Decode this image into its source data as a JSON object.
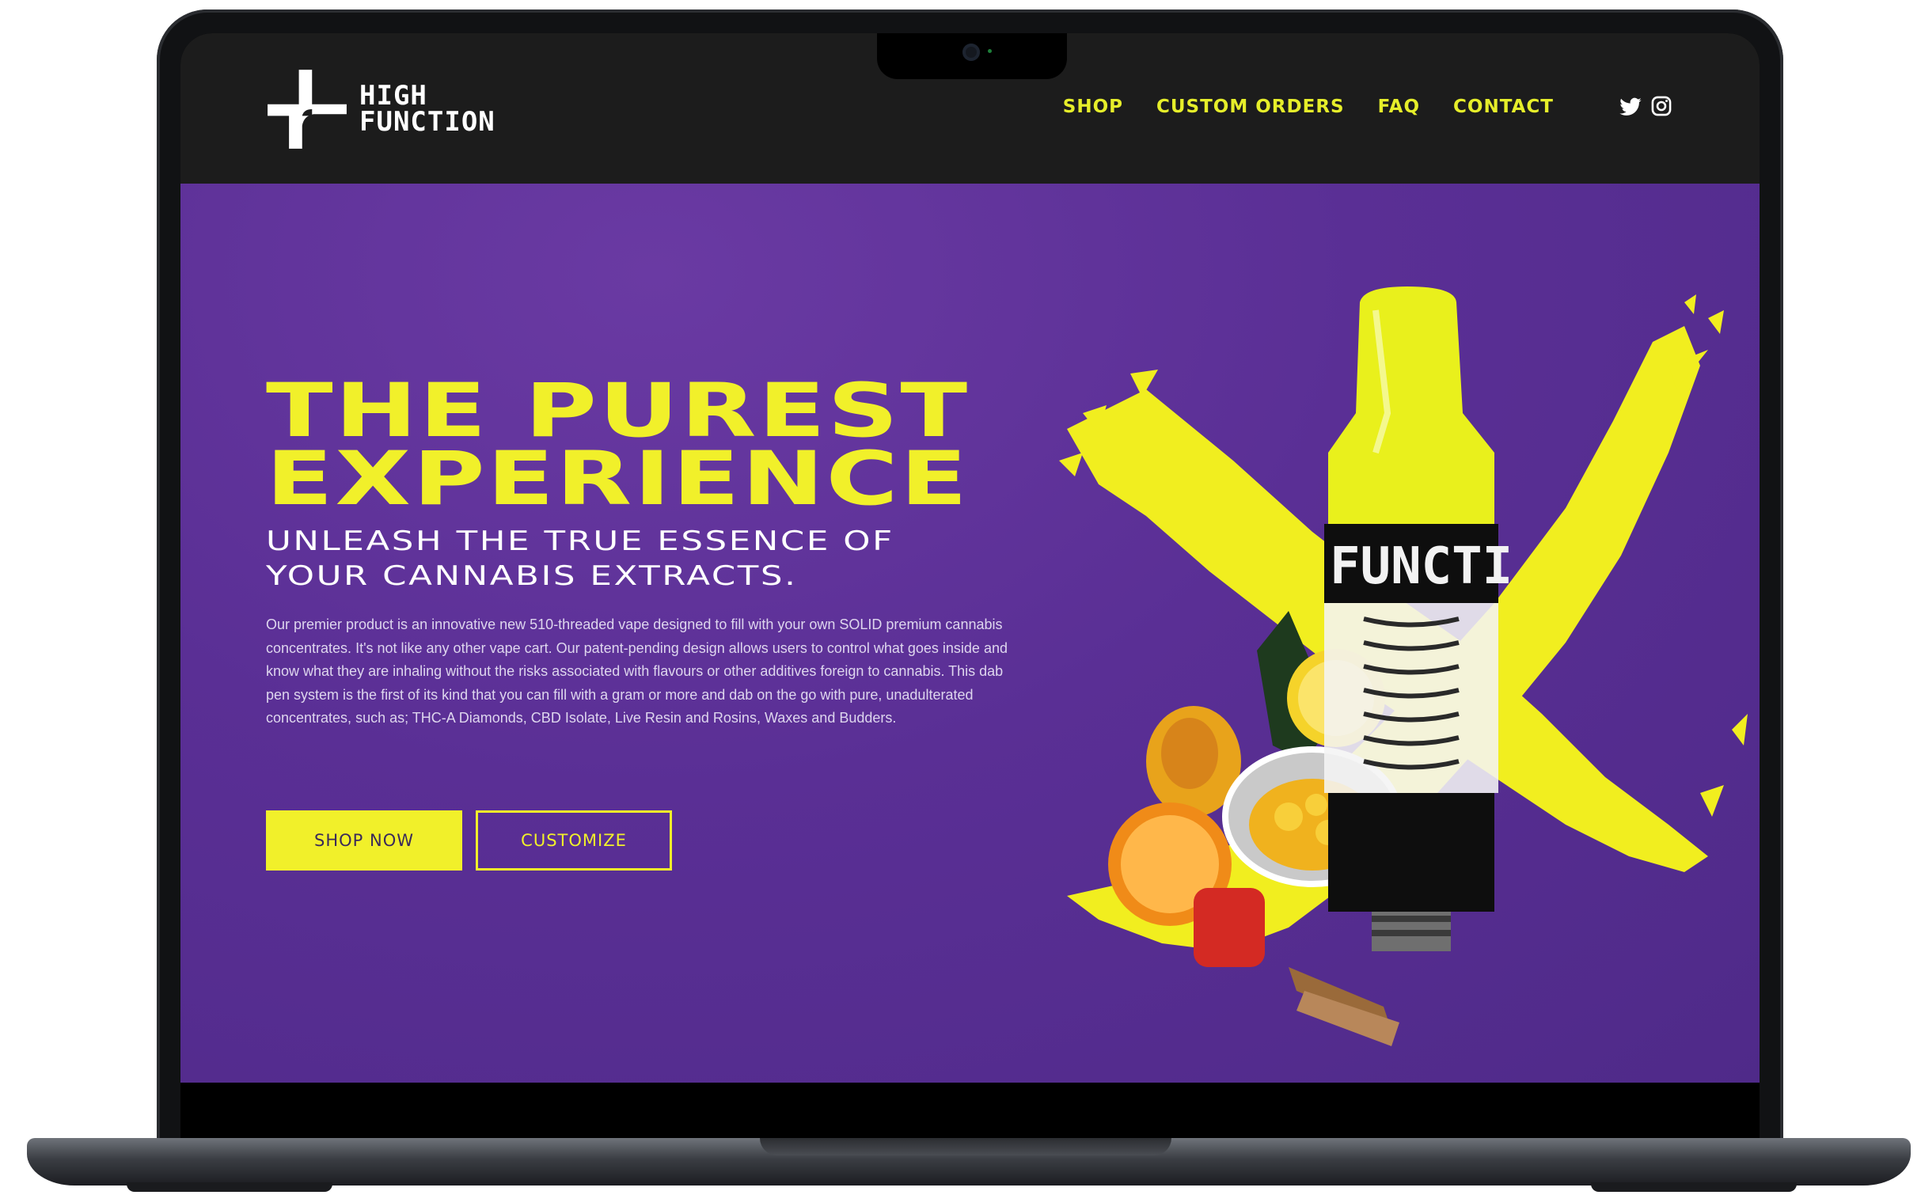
{
  "brand": {
    "line1": "HIGH",
    "line2": "FUNCTION"
  },
  "nav": {
    "items": [
      {
        "label": "SHOP"
      },
      {
        "label": "CUSTOM ORDERS"
      },
      {
        "label": "FAQ"
      },
      {
        "label": "CONTACT"
      }
    ]
  },
  "social": {
    "icons": [
      "twitter-icon",
      "instagram-icon"
    ]
  },
  "hero": {
    "headline_1": "THE PUREST",
    "headline_2": "EXPERIENCE",
    "subhead_1": "UNLEASH THE TRUE ESSENCE OF",
    "subhead_2": "YOUR CANNABIS EXTRACTS.",
    "body": "Our premier product is an innovative new 510-threaded vape designed to fill with your own SOLID premium cannabis concentrates. It's not like any other vape cart. Our patent-pending design allows users to control what goes inside and know what they are inhaling without the risks associated with flavours or other additives foreign to cannabis. This dab pen system is the first of its kind that you can fill with a gram or more and dab on the go with pure, unadulterated concentrates, such as; THC-A Diamonds, CBD Isolate, Live Resin and Rosins, Waxes and Budders.",
    "shop_button": "SHOP NOW",
    "customize_button": "CUSTOMIZE",
    "product_label": "FUNCTI"
  },
  "colors": {
    "accent_yellow": "#f1f02a",
    "hero_purple": "#5a2f95",
    "header_dark": "#1c1c1c"
  }
}
